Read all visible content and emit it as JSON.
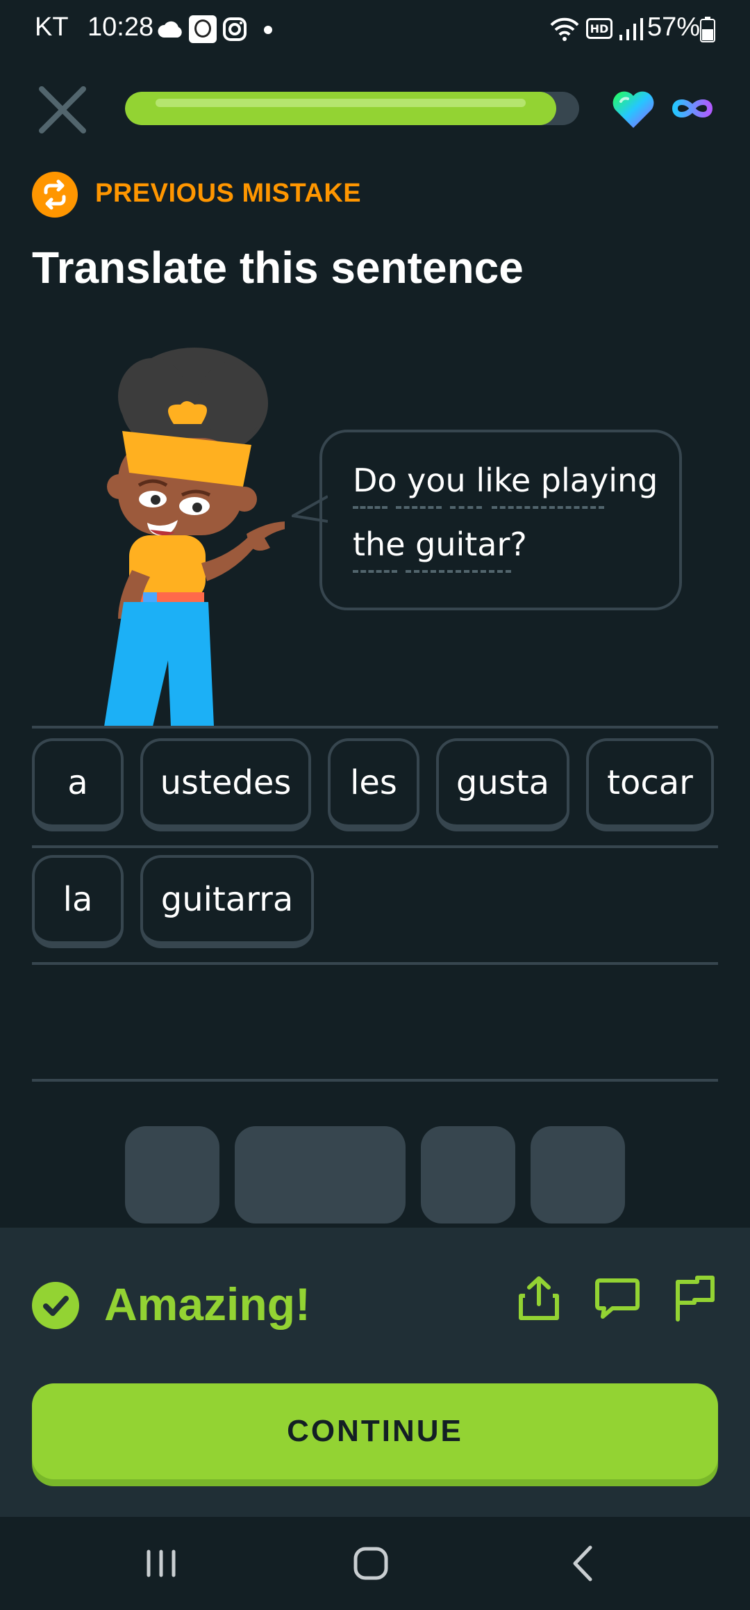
{
  "status_bar": {
    "carrier": "KT",
    "time": "10:28",
    "battery": "57%",
    "icons": [
      "cloud-icon",
      "avatar-notification-icon",
      "instagram-icon",
      "dot-icon",
      "wifi-icon",
      "hd-icon",
      "signal-icon",
      "battery-icon"
    ]
  },
  "header": {
    "close_icon": "close-icon",
    "progress": 0.95,
    "hearts_icon": "heart-icon",
    "hearts_value_icon": "infinity-icon"
  },
  "challenge": {
    "tag_label": "PREVIOUS MISTAKE",
    "title": "Translate this sentence",
    "prompt_line1": "Do you like playing",
    "prompt_line2": "the guitar?"
  },
  "word_bank_answer": {
    "row1": [
      "a",
      "ustedes",
      "les",
      "gusta",
      "tocar"
    ],
    "row2": [
      "la",
      "guitarra"
    ]
  },
  "feedback": {
    "message": "Amazing!",
    "continue_label": "CONTINUE",
    "icons": [
      "share-icon",
      "comment-icon",
      "report-flag-icon"
    ]
  },
  "colors": {
    "background": "#131f24",
    "accent_green": "#93d333",
    "orange": "#ff9600",
    "border": "#37464f",
    "panel": "#202f36"
  }
}
